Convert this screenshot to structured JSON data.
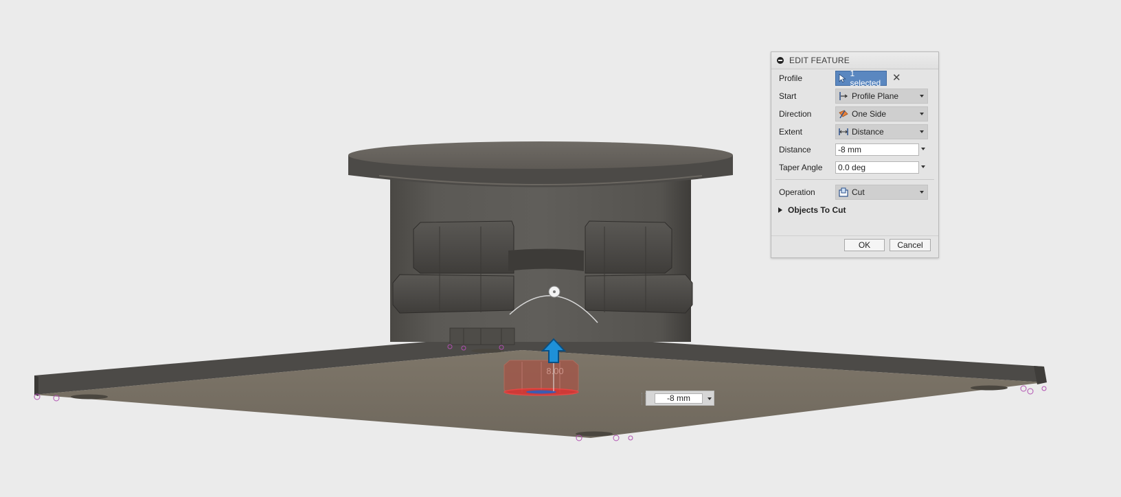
{
  "dialog": {
    "title": "EDIT FEATURE",
    "rows": {
      "profile": {
        "label": "Profile",
        "value": "1 selected",
        "icon": "cursor-icon"
      },
      "start": {
        "label": "Start",
        "value": "Profile Plane",
        "icon": "profile-plane-icon"
      },
      "direction": {
        "label": "Direction",
        "value": "One Side",
        "icon": "one-side-icon"
      },
      "extent": {
        "label": "Extent",
        "value": "Distance",
        "icon": "distance-icon"
      },
      "distance": {
        "label": "Distance",
        "value": "-8 mm"
      },
      "taper": {
        "label": "Taper Angle",
        "value": "0.0 deg"
      },
      "operation": {
        "label": "Operation",
        "value": "Cut",
        "icon": "cut-icon"
      }
    },
    "objects_to_cut": "Objects To Cut",
    "ok": "OK",
    "cancel": "Cancel"
  },
  "canvas": {
    "distance_field": "-8 mm",
    "model_label": "8.00"
  },
  "colors": {
    "selection_blue": "#5a87c0",
    "manipulator_arrow": "#1e90d8",
    "profile_highlight": "#e03030"
  }
}
